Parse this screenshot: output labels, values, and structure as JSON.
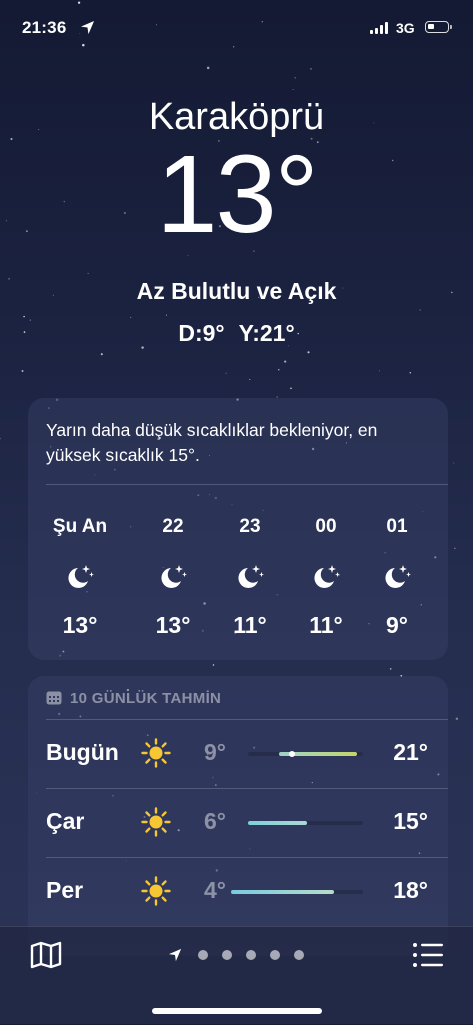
{
  "status": {
    "time": "21:36",
    "network": "3G"
  },
  "header": {
    "city": "Karaköprü",
    "temperature": "13°",
    "condition": "Az Bulutlu ve Açık",
    "low": "D:9°",
    "high": "Y:21°"
  },
  "hourly": {
    "summary": "Yarın daha düşük sıcaklıklar bekleniyor, en yüksek sıcaklık 15°.",
    "items": [
      {
        "time": "Şu An",
        "icon": "moon-stars-icon",
        "temp": "13°"
      },
      {
        "time": "22",
        "icon": "moon-stars-icon",
        "temp": "13°"
      },
      {
        "time": "23",
        "icon": "moon-stars-icon",
        "temp": "11°"
      },
      {
        "time": "00",
        "icon": "moon-stars-icon",
        "temp": "11°"
      },
      {
        "time": "01",
        "icon": "moon-stars-icon",
        "temp": "9°"
      }
    ]
  },
  "daily": {
    "title": "10 GÜNLÜK TAHMİN",
    "rows": [
      {
        "day": "Bugün",
        "icon": "sun-icon",
        "low": "9°",
        "high": "21°",
        "range_start": 0.27,
        "range_end": 0.95,
        "current": 0.38,
        "colors": [
          "#9fd4c8",
          "#c4d66a"
        ]
      },
      {
        "day": "Çar",
        "icon": "sun-icon",
        "low": "6°",
        "high": "15°",
        "range_start": 0.0,
        "range_end": 0.51,
        "colors": [
          "#7fd0d9",
          "#a9d8d6"
        ]
      },
      {
        "day": "Per",
        "icon": "sun-icon",
        "low": "4°",
        "high": "18°",
        "range_start": -0.15,
        "range_end": 0.75,
        "colors": [
          "#79cbe0",
          "#b6dcc8"
        ]
      }
    ]
  },
  "bottom": {
    "page_count": 5
  },
  "colors": {
    "sun": "#f7c633",
    "background_top": "#141a33",
    "background_bottom": "#2c3458"
  }
}
